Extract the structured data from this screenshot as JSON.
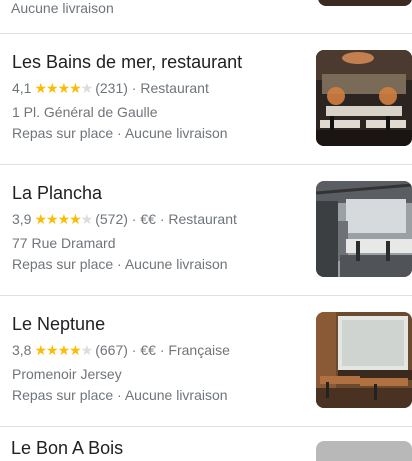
{
  "top_fragment": {
    "text": "Aucune livraison"
  },
  "results": [
    {
      "name": "Les Bains de mer, restaurant",
      "rating": "4,1",
      "stars_filled": 4,
      "reviews": "(231)",
      "price": "",
      "category": "Restaurant",
      "address": "1 Pl. Général de Gaulle",
      "services": "Repas sur place · Aucune livraison"
    },
    {
      "name": "La Plancha",
      "rating": "3,9",
      "stars_filled": 4,
      "reviews": "(572)",
      "price": "€€",
      "category": "Restaurant",
      "address": "77 Rue Dramard",
      "services": "Repas sur place · Aucune livraison"
    },
    {
      "name": "Le Neptune",
      "rating": "3,8",
      "stars_filled": 4,
      "reviews": "(667)",
      "price": "€€",
      "category": "Française",
      "address": "Promenoir Jersey",
      "services": "Repas sur place · Aucune livraison"
    }
  ],
  "partial_next": {
    "name": "Le Bon A Bois"
  },
  "colors": {
    "star": "#fbbc04",
    "star_empty": "#dadce0",
    "secondary_text": "#70757a",
    "primary_text": "#202124",
    "divider": "#e0e0e0"
  }
}
